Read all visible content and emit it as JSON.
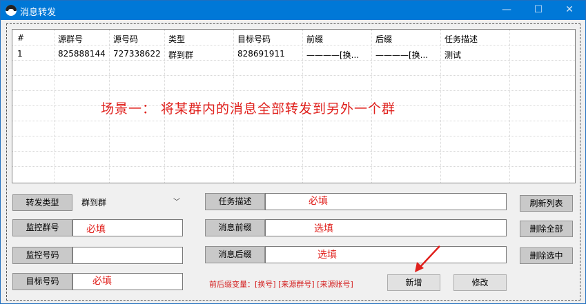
{
  "window": {
    "title": "消息转发",
    "accent": "#0078d7",
    "controls": {
      "minimize": "—",
      "maximize": "☐",
      "close": "✕"
    }
  },
  "grid": {
    "columns": [
      "#",
      "源群号",
      "源号码",
      "类型",
      "目标号码",
      "前缀",
      "后缀",
      "任务描述"
    ],
    "rows": [
      [
        "1",
        "825888144",
        "727338622",
        "群到群",
        "828691911",
        "————[换...",
        "————[换...",
        "测试"
      ]
    ]
  },
  "annotation": {
    "scene": "场景一：  将某群内的消息全部转发到另外一个群",
    "color": "#e0201c"
  },
  "form": {
    "forward_type_label": "转发类型",
    "forward_type_value": "群到群",
    "monitor_group_label": "监控群号",
    "monitor_group_hint": "必填",
    "monitor_number_label": "监控号码",
    "target_number_label": "目标号码",
    "target_number_hint": "必填",
    "task_desc_label": "任务描述",
    "task_desc_hint": "必填",
    "msg_prefix_label": "消息前缀",
    "msg_prefix_hint": "选填",
    "msg_suffix_label": "消息后缀",
    "msg_suffix_hint": "选填",
    "vars_label": "前后缀变量：[换号] [来源群号] [来源账号]"
  },
  "buttons": {
    "refresh": "刷新列表",
    "delete_all": "删除全部",
    "delete_selected": "删除选中",
    "add": "新增",
    "edit": "修改"
  }
}
